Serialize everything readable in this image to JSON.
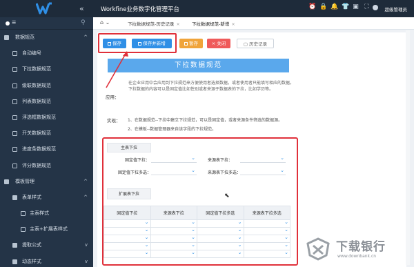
{
  "header": {
    "app_title": "Workfine业务数字化管理平台",
    "user_name": "超级管理员",
    "collapse_glyph": "«"
  },
  "sidebar": {
    "items": [
      {
        "label": "数据规范",
        "level": 0,
        "arrow": "^"
      },
      {
        "label": "自动编号",
        "level": 1
      },
      {
        "label": "下拉数据规范",
        "level": 1
      },
      {
        "label": "级联数据规范",
        "level": 1
      },
      {
        "label": "列表数据规范",
        "level": 1
      },
      {
        "label": "浮选框数据规范",
        "level": 1
      },
      {
        "label": "开关数据规范",
        "level": 1
      },
      {
        "label": "进度条数据规范",
        "level": 1
      },
      {
        "label": "评分数据规范",
        "level": 1
      },
      {
        "label": "模板管理",
        "level": 0,
        "arrow": "^"
      },
      {
        "label": "表单样式",
        "level": 1,
        "arrow": "^"
      },
      {
        "label": "主表样式",
        "level": 2
      },
      {
        "label": "主表+扩展表样式",
        "level": 2
      },
      {
        "label": "提取公式",
        "level": 1,
        "arrow": "v"
      },
      {
        "label": "动态样式",
        "level": 1,
        "arrow": "v"
      }
    ]
  },
  "tabs": [
    {
      "label": "下拉数据规范-历史记录",
      "close": "×"
    },
    {
      "label": "下拉数据规范-新增",
      "close": "×"
    }
  ],
  "toolbar": {
    "save": "保存",
    "save_new": "保存并新增",
    "draft": "暂存",
    "close": "关闭",
    "history": "历史记录"
  },
  "doc": {
    "banner": "下拉数据规范",
    "app_label": "应用：",
    "app_desc": "在企业应用中会应用到下拉规范来方便使用者选择数据，或者使用者只能填写相应的数据。下拉数据的内容可以是固定值比如性别或者来源于数据表的下拉，比如学历等。",
    "example_label": "实现：",
    "example_lines": [
      "1、在数据规范--下拉中建立下拉规范，可以是固定值，或者来源条件筛选的数据源。",
      "2、在模板--数据管理器来自该字段的下拉规范。"
    ]
  },
  "form": {
    "main_section": "主表下拉",
    "fields": [
      {
        "label": "固定值下拉："
      },
      {
        "label": "来源表下拉："
      },
      {
        "label": "固定值下拉多选："
      },
      {
        "label": "来源表下拉多选："
      }
    ],
    "ext_section": "扩展表下拉",
    "table_headers": [
      "固定值下拉",
      "来源表下拉",
      "固定值下拉多选",
      "来源表下拉多选"
    ],
    "table_rows": 5
  },
  "watermark": {
    "text": "下载银行",
    "url": "www.downbank.cn"
  },
  "colors": {
    "primary": "#2f8fe6",
    "warning": "#f0a43a",
    "danger": "#ef5a5a",
    "highlight": "#e0303a",
    "sidebar": "#243447",
    "header": "#1e2b3a"
  }
}
